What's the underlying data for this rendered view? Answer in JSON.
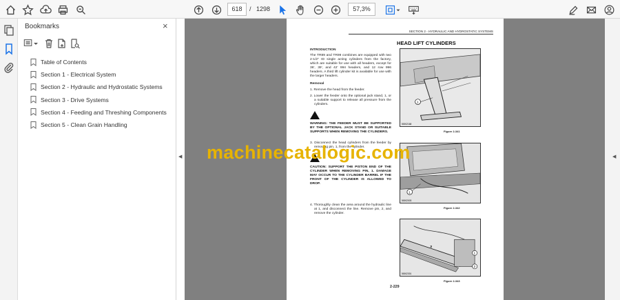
{
  "toolbar": {
    "page_current": "618",
    "page_separator": "/",
    "page_total": "1298",
    "zoom": "57,3%"
  },
  "panel": {
    "title": "Bookmarks",
    "close": "×"
  },
  "bookmarks": [
    {
      "label": "Table of Contents"
    },
    {
      "label": "Section 1 - Electrical System"
    },
    {
      "label": "Section 2 - Hydraulic and Hydrostatic Systems"
    },
    {
      "label": "Section 3 - Drive Systems"
    },
    {
      "label": "Section 4 - Feeding and Threshing Components"
    },
    {
      "label": "Section 5 - Clean Grain Handling"
    }
  ],
  "document": {
    "header": "SECTION 2 - HYDRAULIC AND HYDROSTATIC SYSTEMS",
    "title": "HEAD LIFT CYLINDERS",
    "intro_heading": "INTRODUCTION",
    "intro_text": "The TR89 and TR99 combines are equipped with two 2-1/2\" ID single acting cylinders from the factory, which are suitable for use with all headers, except for 36', 39', and 42' 994 headers, and 12 row 996 headers. A third lift cylinder kit is available for use with the larger headers.",
    "removal_heading": "Removal",
    "step1": "1.  Remove the head from the feeder.",
    "step2": "2.  Lower the feeder onto the optional jack stand, 1, or a suitable support to release all pressure from the cylinders.",
    "warning": "WARNING: THE FEEDER MUST BE SUPPORTED BY THE OPTIONAL JACK STAND OR SUITABLE SUPPORTS WHEN REMOVING THE CYLINDERS.",
    "step3": "3.  Disconnect the head cylinders from the feeder by removing pin, 1, from the cylinder.",
    "caution": "CAUTION: SUPPORT THE PISTON END OF THE CYLINDER WHEN REMOVING PIN, 1. DAMAGE MAY OCCUR TO THE CYLINDER BARREL IF THE FRONT OF THE CYLINDER IS ALLOWED TO DROP.",
    "step4": "4.  Thoroughly clean the area around the hydraulic line at 1, and disconnect the line. Remove pin, 2, and remove the cylinder.",
    "fig1_caption": "Figure 2-341",
    "fig2_caption": "Figure 2-342",
    "fig3_caption": "Figure 2-343",
    "fig1_id": "50002168",
    "fig2_id": "50002003",
    "fig3_id": "50002301",
    "fig1_callout": "1",
    "fig2_callout": "1",
    "fig3_callout_a": "1",
    "fig3_callout_b": "2",
    "fig3_callout_c": "3",
    "page_number": "2-229"
  },
  "watermark": "machinecatalogic.com"
}
